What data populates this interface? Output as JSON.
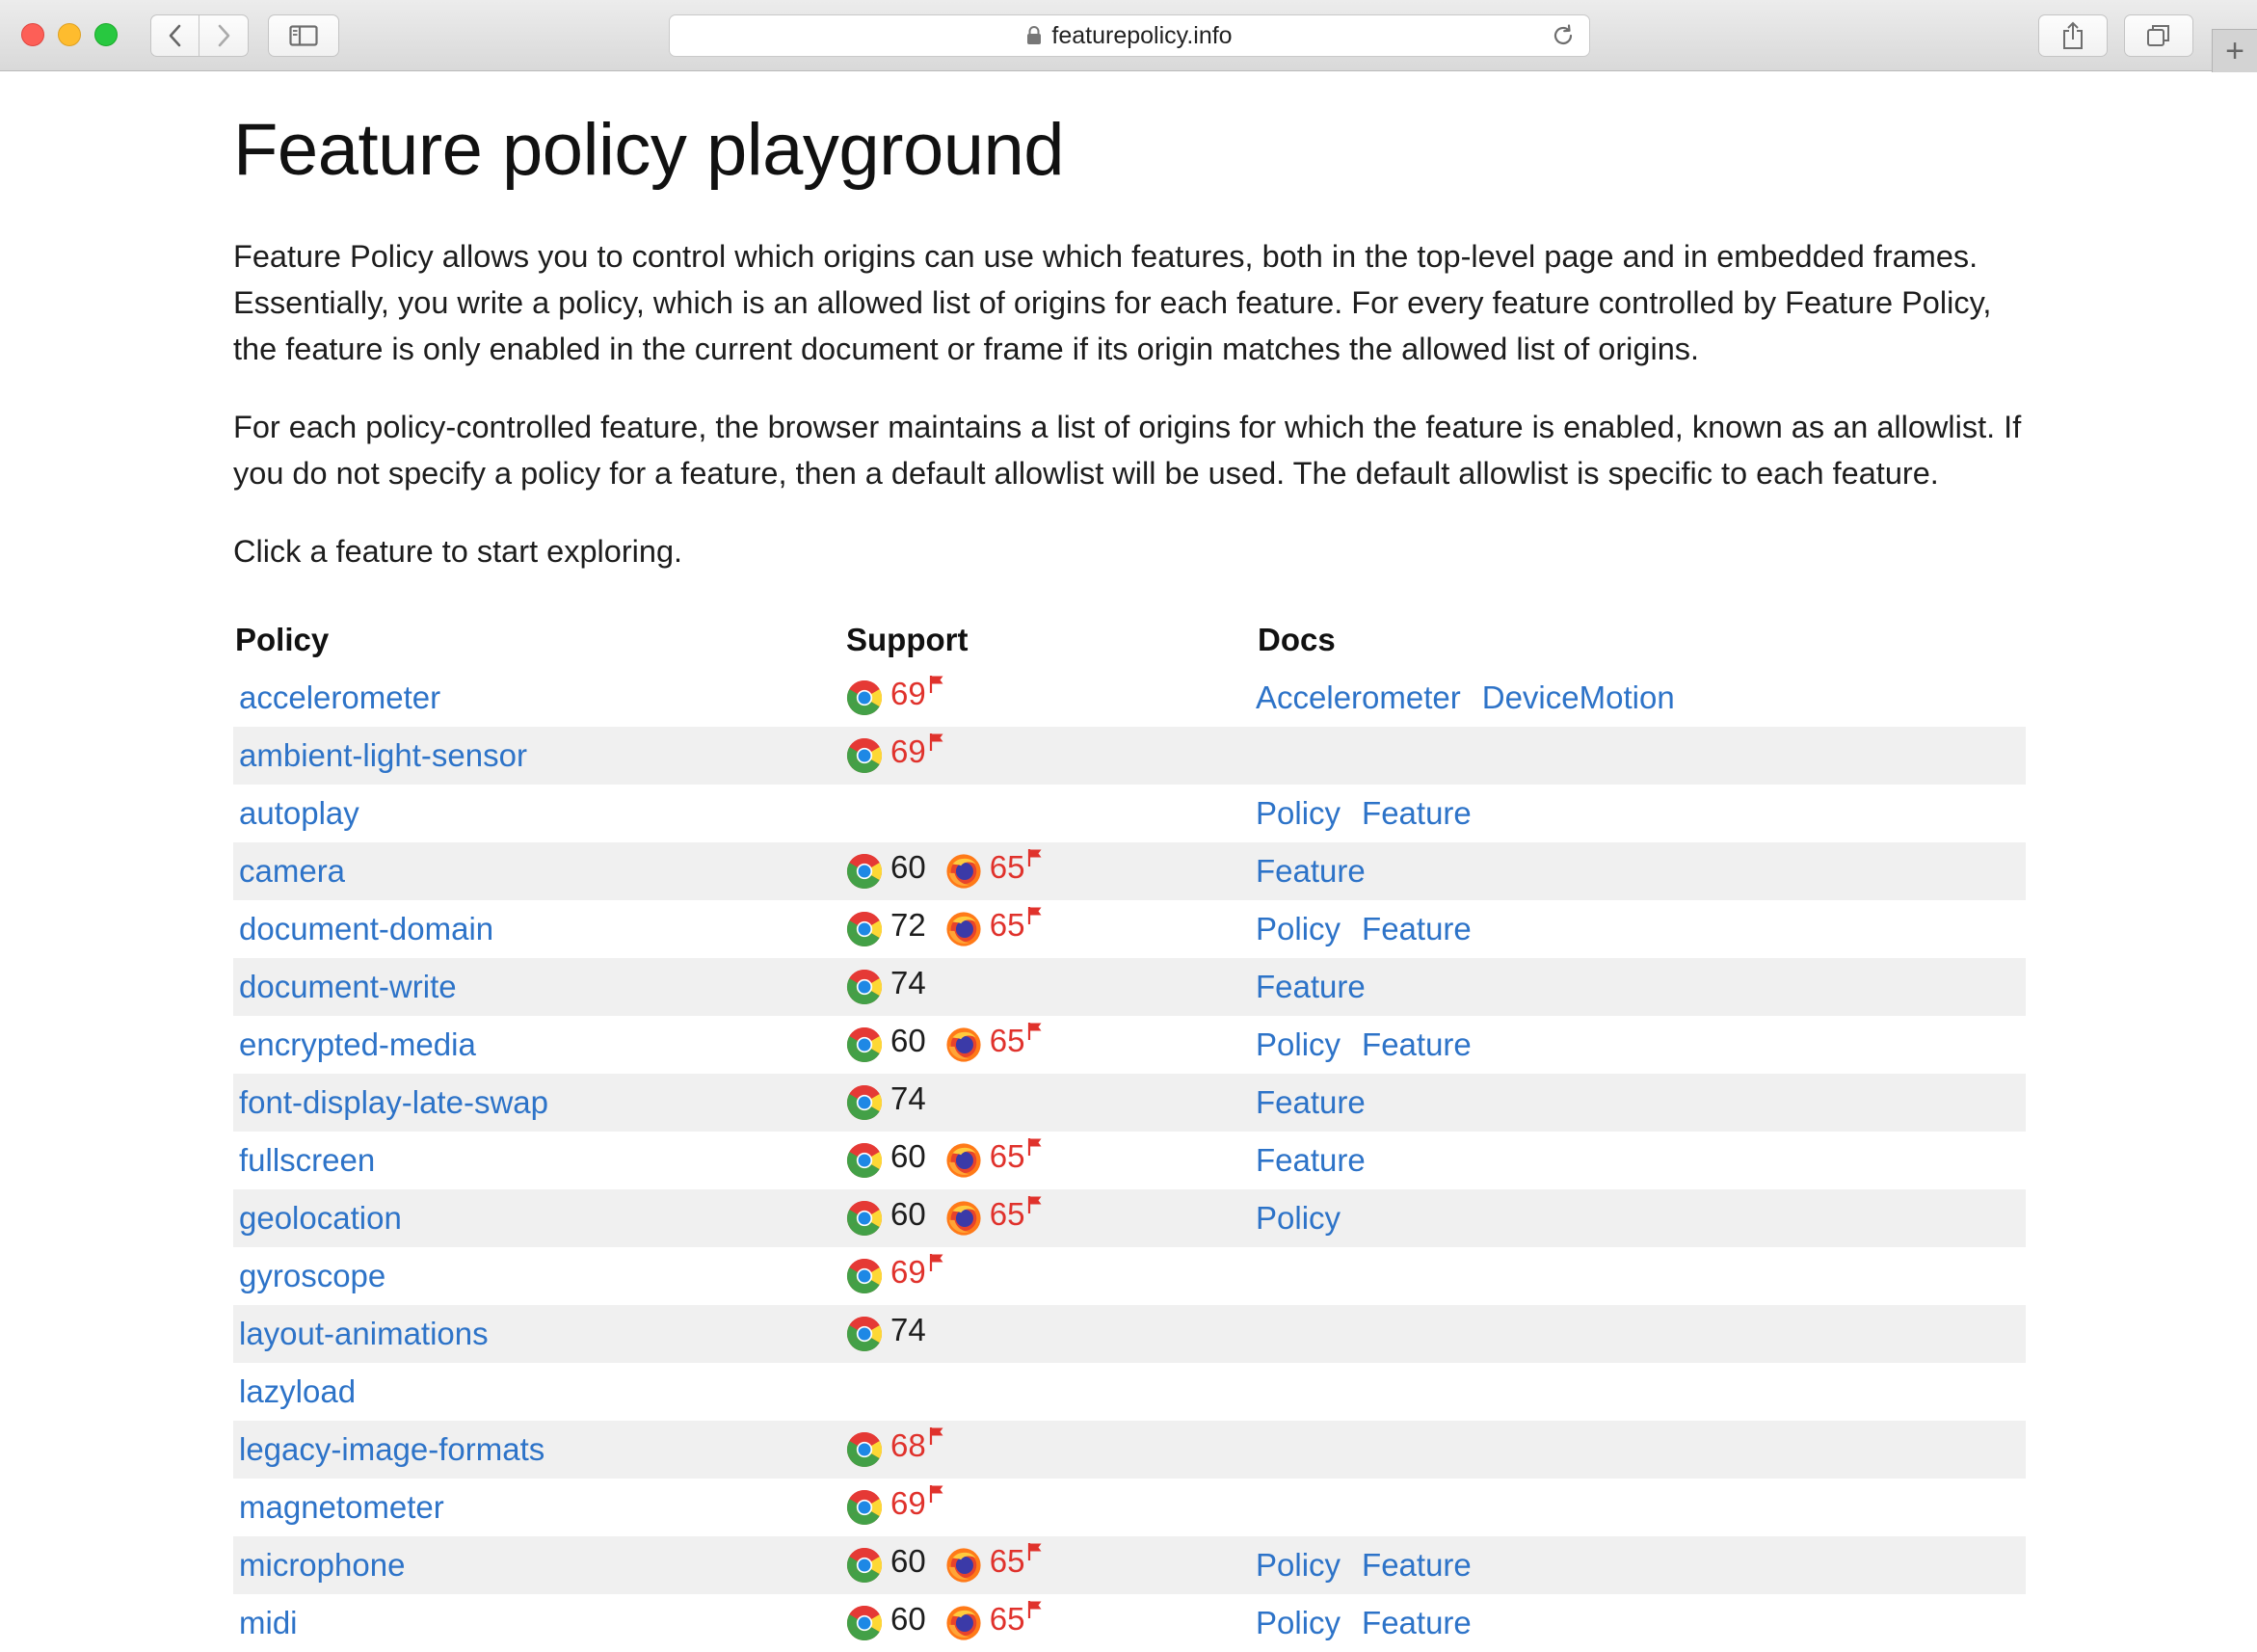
{
  "browser": {
    "url": "featurepolicy.info"
  },
  "page": {
    "title": "Feature policy playground",
    "intro_p1": "Feature Policy allows you to control which origins can use which features, both in the top-level page and in embedded frames. Essentially, you write a policy, which is an allowed list of origins for each feature. For every feature controlled by Feature Policy, the feature is only enabled in the current document or frame if its origin matches the allowed list of origins.",
    "intro_p2": "For each policy-controlled feature, the browser maintains a list of origins for which the feature is enabled, known as an allowlist. If you do not specify a policy for a feature, then a default allowlist will be used. The default allowlist is specific to each feature.",
    "intro_p3": "Click a feature to start exploring."
  },
  "table": {
    "headers": {
      "policy": "Policy",
      "support": "Support",
      "docs": "Docs"
    },
    "rows": [
      {
        "policy": "accelerometer",
        "support": [
          {
            "browser": "chrome",
            "version": "69",
            "flag": true
          }
        ],
        "docs": [
          "Accelerometer",
          "DeviceMotion"
        ]
      },
      {
        "policy": "ambient-light-sensor",
        "support": [
          {
            "browser": "chrome",
            "version": "69",
            "flag": true
          }
        ],
        "docs": []
      },
      {
        "policy": "autoplay",
        "support": [],
        "docs": [
          "Policy",
          "Feature"
        ]
      },
      {
        "policy": "camera",
        "support": [
          {
            "browser": "chrome",
            "version": "60",
            "flag": false
          },
          {
            "browser": "firefox",
            "version": "65",
            "flag": true
          }
        ],
        "docs": [
          "Feature"
        ]
      },
      {
        "policy": "document-domain",
        "support": [
          {
            "browser": "chrome",
            "version": "72",
            "flag": false
          },
          {
            "browser": "firefox",
            "version": "65",
            "flag": true
          }
        ],
        "docs": [
          "Policy",
          "Feature"
        ]
      },
      {
        "policy": "document-write",
        "support": [
          {
            "browser": "chrome",
            "version": "74",
            "flag": false
          }
        ],
        "docs": [
          "Feature"
        ]
      },
      {
        "policy": "encrypted-media",
        "support": [
          {
            "browser": "chrome",
            "version": "60",
            "flag": false
          },
          {
            "browser": "firefox",
            "version": "65",
            "flag": true
          }
        ],
        "docs": [
          "Policy",
          "Feature"
        ]
      },
      {
        "policy": "font-display-late-swap",
        "support": [
          {
            "browser": "chrome",
            "version": "74",
            "flag": false
          }
        ],
        "docs": [
          "Feature"
        ]
      },
      {
        "policy": "fullscreen",
        "support": [
          {
            "browser": "chrome",
            "version": "60",
            "flag": false
          },
          {
            "browser": "firefox",
            "version": "65",
            "flag": true
          }
        ],
        "docs": [
          "Feature"
        ]
      },
      {
        "policy": "geolocation",
        "support": [
          {
            "browser": "chrome",
            "version": "60",
            "flag": false
          },
          {
            "browser": "firefox",
            "version": "65",
            "flag": true
          }
        ],
        "docs": [
          "Policy"
        ]
      },
      {
        "policy": "gyroscope",
        "support": [
          {
            "browser": "chrome",
            "version": "69",
            "flag": true
          }
        ],
        "docs": []
      },
      {
        "policy": "layout-animations",
        "support": [
          {
            "browser": "chrome",
            "version": "74",
            "flag": false
          }
        ],
        "docs": []
      },
      {
        "policy": "lazyload",
        "support": [],
        "docs": []
      },
      {
        "policy": "legacy-image-formats",
        "support": [
          {
            "browser": "chrome",
            "version": "68",
            "flag": true
          }
        ],
        "docs": []
      },
      {
        "policy": "magnetometer",
        "support": [
          {
            "browser": "chrome",
            "version": "69",
            "flag": true
          }
        ],
        "docs": []
      },
      {
        "policy": "microphone",
        "support": [
          {
            "browser": "chrome",
            "version": "60",
            "flag": false
          },
          {
            "browser": "firefox",
            "version": "65",
            "flag": true
          }
        ],
        "docs": [
          "Policy",
          "Feature"
        ]
      },
      {
        "policy": "midi",
        "support": [
          {
            "browser": "chrome",
            "version": "60",
            "flag": false
          },
          {
            "browser": "firefox",
            "version": "65",
            "flag": true
          }
        ],
        "docs": [
          "Policy",
          "Feature"
        ]
      }
    ]
  },
  "colors": {
    "link": "#2d73c8",
    "flagged_version": "#e0322c",
    "row_stripe": "#f0f0f0"
  },
  "icons": {
    "chrome": "chrome-logo-icon",
    "firefox": "firefox-logo-icon",
    "flag": "flag-icon"
  }
}
